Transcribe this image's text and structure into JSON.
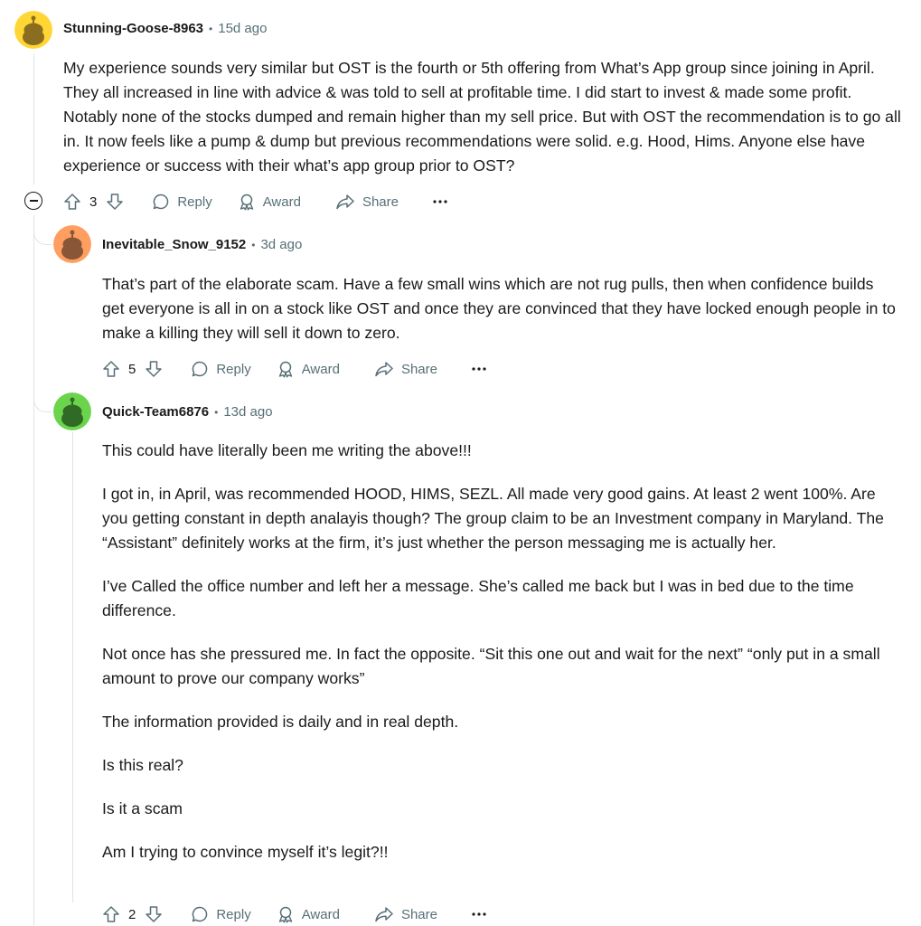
{
  "comments": [
    {
      "username": "Stunning-Goose-8963",
      "separator": "•",
      "time": "15d ago",
      "avatar_color": "#ffd635",
      "paragraphs": [
        "My experience sounds very similar but OST is the fourth or 5th offering from What’s App group since joining in April. They all increased in line with advice & was told to sell at profitable time. I did start to invest & made some profit. Notably none of the stocks dumped and remain higher than my sell price. But with OST the recommendation is to go all in. It now feels like a pump & dump but previous recommendations were solid. e.g. Hood, Hims. Anyone else have experience or success with their what’s app group prior to OST?"
      ],
      "score": "3",
      "reply_label": "Reply",
      "award_label": "Award",
      "share_label": "Share",
      "more_label": "···"
    },
    {
      "username": "Inevitable_Snow_9152",
      "separator": "•",
      "time": "3d ago",
      "avatar_color": "#ff9e61",
      "paragraphs": [
        "That’s part of the elaborate scam. Have a few small wins which are not rug pulls, then when confidence builds get everyone is all in on a stock like OST and once they are convinced that they have locked enough people in to make a killing they will sell it down to zero."
      ],
      "score": "5",
      "reply_label": "Reply",
      "award_label": "Award",
      "share_label": "Share",
      "more_label": "···"
    },
    {
      "username": "Quick-Team6876",
      "separator": "•",
      "time": "13d ago",
      "avatar_color": "#6bd44c",
      "paragraphs": [
        "This could have literally been me writing the above!!!",
        "I got in, in April, was recommended HOOD, HIMS, SEZL. All made very good gains. At least 2 went 100%. Are you getting constant in depth analayis though? The group claim to be an Investment company in Maryland. The “Assistant” definitely works at the firm, it’s just whether the person messaging me is actually her.",
        "I’ve Called the office number and left her a message. She’s called me back but I was in bed due to the time difference.",
        "Not once has she pressured me. In fact the opposite. “Sit this one out and wait for the next” “only put in a small amount to prove our company works”",
        "The information provided is daily and in real depth.",
        "Is this real?",
        "Is it a scam",
        "Am I trying to convince myself it’s legit?!!"
      ],
      "score": "2",
      "reply_label": "Reply",
      "award_label": "Award",
      "share_label": "Share",
      "more_label": "···"
    }
  ],
  "colors": {
    "meta_gray": "#576f76",
    "text": "#1a1a1b",
    "thread_line": "#dfe3e6"
  },
  "icons": [
    "upvote-icon",
    "downvote-icon",
    "comment-icon",
    "award-icon",
    "share-icon",
    "more-icon",
    "collapse-icon",
    "snoo-avatar-icon"
  ]
}
